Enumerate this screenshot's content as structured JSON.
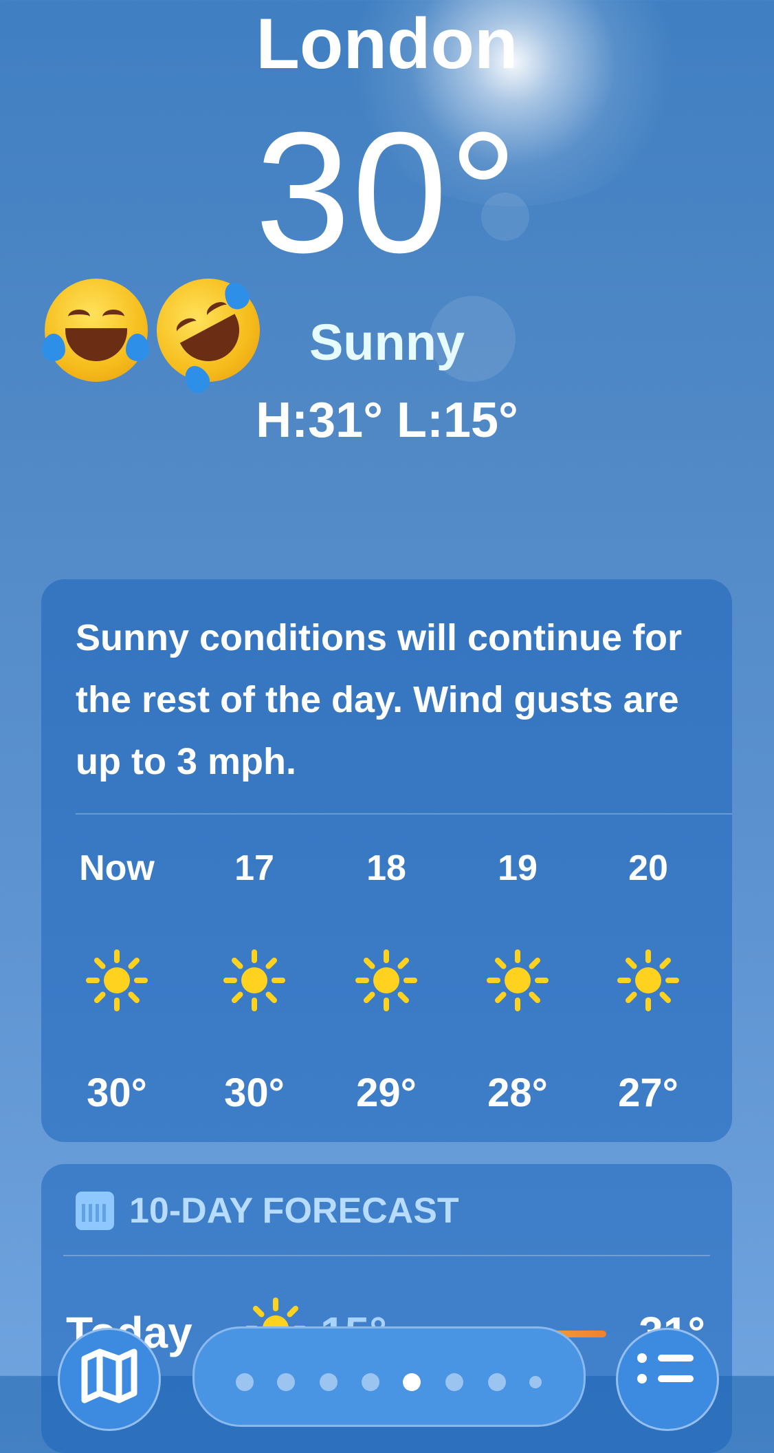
{
  "header": {
    "city": "London",
    "temperature": "30°",
    "condition": "Sunny",
    "high_low": "H:31°  L:15°"
  },
  "emojis": [
    "face-with-tears-of-joy",
    "rolling-on-the-floor-laughing"
  ],
  "summary": {
    "text": "Sunny conditions will continue for the rest of the day. Wind gusts are up to 3 mph."
  },
  "hourly": [
    {
      "label": "Now",
      "icon": "sun-icon",
      "temp": "30°"
    },
    {
      "label": "17",
      "icon": "sun-icon",
      "temp": "30°"
    },
    {
      "label": "18",
      "icon": "sun-icon",
      "temp": "29°"
    },
    {
      "label": "19",
      "icon": "sun-icon",
      "temp": "28°"
    },
    {
      "label": "20",
      "icon": "sun-icon",
      "temp": "27°"
    }
  ],
  "forecast": {
    "title": "10-DAY FORECAST",
    "today": {
      "day": "Today",
      "low": "15°",
      "high": "31°"
    }
  },
  "toolbar": {
    "page_count": 8,
    "active_page": 5
  },
  "colors": {
    "sun": "#ffd21f",
    "accent": "#b7dcff"
  }
}
